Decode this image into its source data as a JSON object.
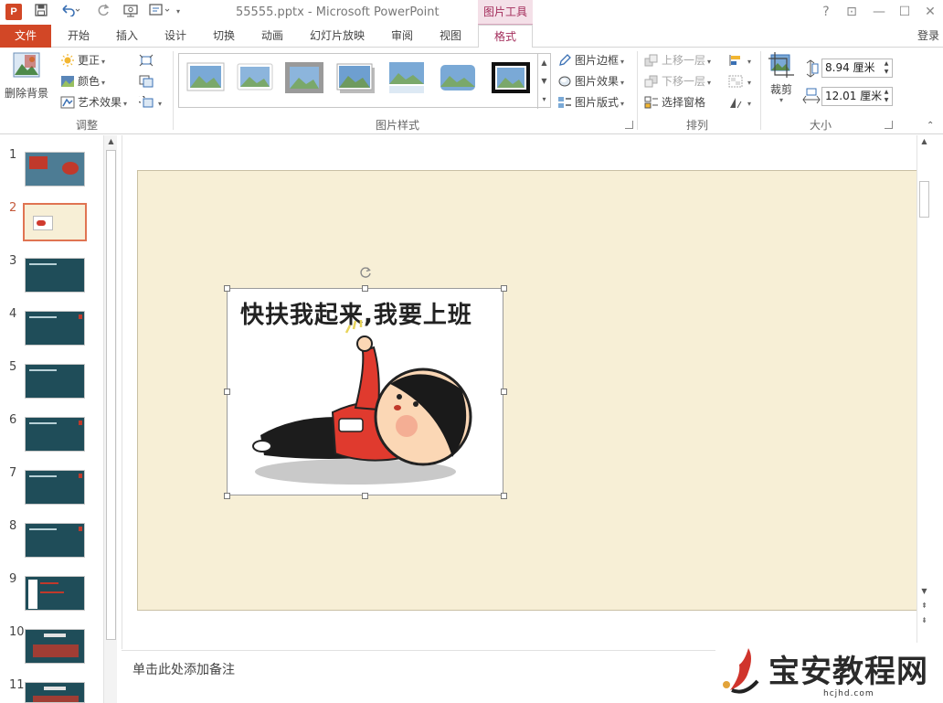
{
  "titlebar": {
    "app_icon_letter": "P",
    "document_title": "55555.pptx - Microsoft PowerPoint",
    "context_tab_group": "图片工具",
    "help": "?",
    "restore_ribbon": "⊡",
    "minimize": "—",
    "maximize": "☐",
    "close": "✕"
  },
  "tabs": {
    "file": "文件",
    "items": [
      "开始",
      "插入",
      "设计",
      "切换",
      "动画",
      "幻灯片放映",
      "审阅",
      "视图",
      "格式"
    ],
    "active": "格式",
    "login": "登录"
  },
  "ribbon": {
    "adjust": {
      "remove_bg": "删除背景",
      "corrections": "更正",
      "color": "颜色",
      "artistic": "艺术效果",
      "group_label": "调整"
    },
    "picture_styles": {
      "border": "图片边框",
      "effects": "图片效果",
      "layout": "图片版式",
      "group_label": "图片样式"
    },
    "arrange": {
      "bring_forward": "上移一层",
      "send_backward": "下移一层",
      "selection_pane": "选择窗格",
      "group_label": "排列"
    },
    "size": {
      "crop": "裁剪",
      "height": "8.94 厘米",
      "width": "12.01 厘米",
      "group_label": "大小"
    }
  },
  "thumbnails": {
    "numbers": [
      "1",
      "2",
      "3",
      "4",
      "5",
      "6",
      "7",
      "8",
      "9",
      "10",
      "11"
    ],
    "selected": "2"
  },
  "slide": {
    "picture_caption": "快扶我起来,我要上班"
  },
  "notes": {
    "placeholder": "单击此处添加备注"
  },
  "watermark": {
    "text": "宝安教程网",
    "url": "hcjhd.com"
  },
  "colors": {
    "accent": "#d24726",
    "context_tab": "#a32d5b",
    "slide_background": "#f7efd6",
    "thumbnail_dark": "#1f4d59"
  }
}
